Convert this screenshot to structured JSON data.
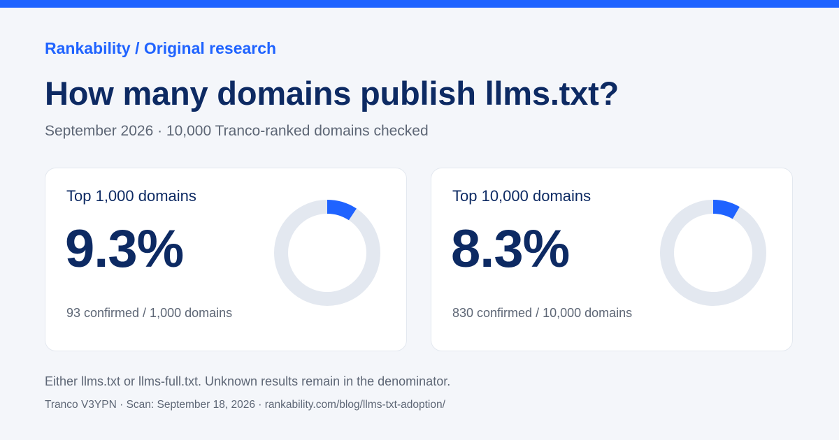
{
  "header": {
    "eyebrow": "Rankability / Original research",
    "title": "How many domains publish llms.txt?",
    "subtitle": "September 2026 · 10,000 Tranco-ranked domains checked"
  },
  "colors": {
    "accent": "#1f63ff",
    "title": "#0d2a63",
    "track": "#e3e8f0",
    "muted": "#5d6675"
  },
  "cards": [
    {
      "label": "Top 1,000 domains",
      "percent_label": "9.3%",
      "percent_value": 9.3,
      "count_text": "93 confirmed / 1,000 domains"
    },
    {
      "label": "Top 10,000 domains",
      "percent_label": "8.3%",
      "percent_value": 8.3,
      "count_text": "830 confirmed / 10,000 domains"
    }
  ],
  "footer": {
    "note": "Either llms.txt or llms-full.txt. Unknown results remain in the denominator.",
    "source": "Tranco V3YPN · Scan: September 18, 2026 · rankability.com/blog/llms-txt-adoption/"
  }
}
